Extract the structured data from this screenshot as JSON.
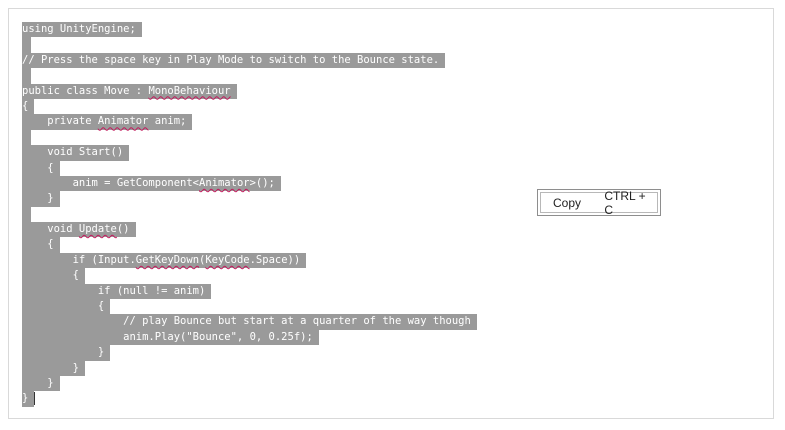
{
  "code_lines": [
    "using UnityEngine;",
    "",
    "// Press the space key in Play Mode to switch to the Bounce state.",
    "",
    "public class Move : MonoBehaviour",
    "{",
    "    private Animator anim;",
    "",
    "    void Start()",
    "    {",
    "        anim = GetComponent<Animator>();",
    "    }",
    "",
    "    void Update()",
    "    {",
    "        if (Input.GetKeyDown(KeyCode.Space))",
    "        {",
    "            if (null != anim)",
    "            {",
    "                // play Bounce but start at a quarter of the way though",
    "                anim.Play(\"Bounce\", 0, 0.25f);",
    "            }",
    "        }",
    "    }",
    "}"
  ],
  "context_menu": {
    "copy_label": "Copy",
    "copy_shortcut": "CTRL + C"
  }
}
